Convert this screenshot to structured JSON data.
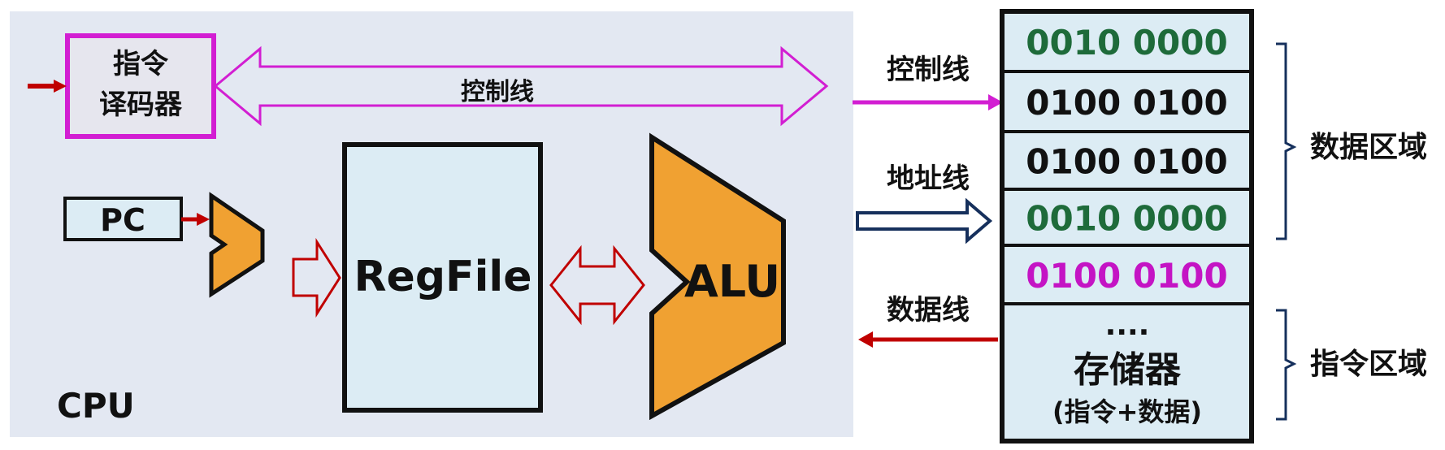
{
  "cpu": {
    "label": "CPU",
    "decoder_line1": "指令",
    "decoder_line2": "译码器",
    "pc": "PC",
    "bus_label": "控制线",
    "regfile": "RegFile",
    "alu": "ALU"
  },
  "buses": {
    "control": "控制线",
    "address": "地址线",
    "data": "数据线"
  },
  "memory": {
    "cells": [
      {
        "value": "0010 0000",
        "color": "#1e6b3a"
      },
      {
        "value": "0100 0100",
        "color": "#111111"
      },
      {
        "value": "0100 0100",
        "color": "#111111"
      },
      {
        "value": "0010 0000",
        "color": "#1e6b3a"
      },
      {
        "value": "0100 0100",
        "color": "#c414c4"
      }
    ],
    "dots": "....",
    "name": "存储器",
    "subtitle": "(指令+数据)"
  },
  "regions": {
    "data": "数据区域",
    "instruction": "指令区域"
  },
  "colors": {
    "cpu_bg": "#e3e8f2",
    "box_fill": "#dcecf4",
    "orange": "#f0a132",
    "magenta": "#d21ed2",
    "red": "#c00000",
    "navy": "#16305c"
  }
}
